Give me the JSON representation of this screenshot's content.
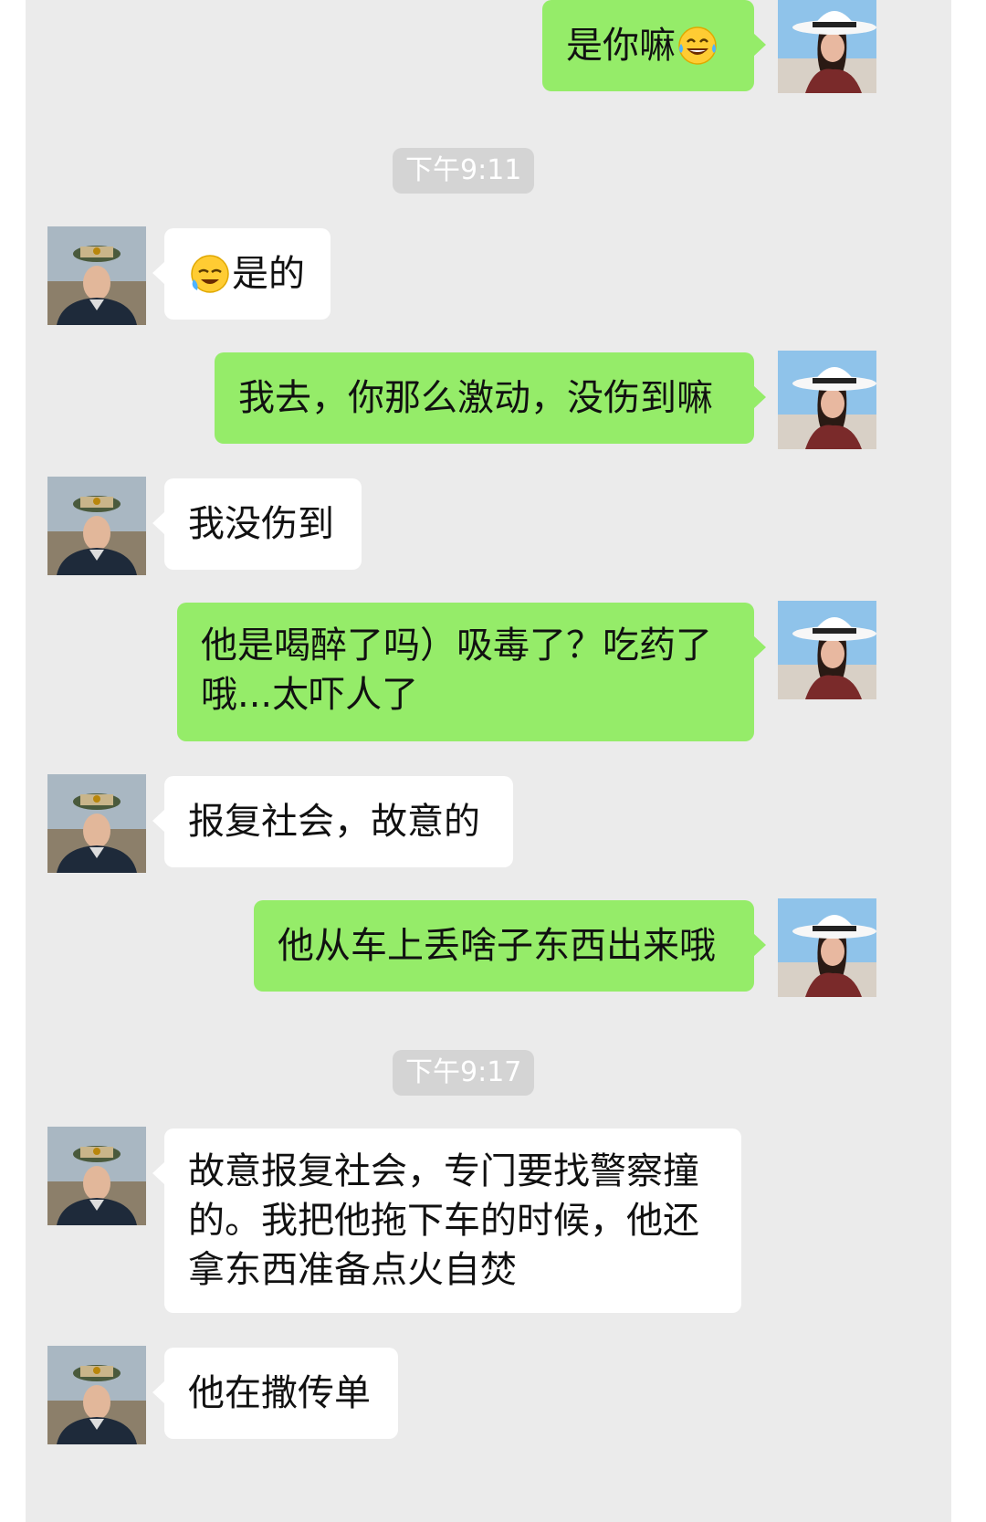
{
  "conversation": {
    "messages": [
      {
        "id": "m1",
        "side": "right",
        "text": "是你嘛",
        "emoji": "tears-of-joy-emoji"
      },
      {
        "id": "t1",
        "type": "time",
        "text": "下午9:11"
      },
      {
        "id": "m2",
        "side": "left",
        "emoji": "crying-laughing-emoji",
        "text": "是的"
      },
      {
        "id": "m3",
        "side": "right",
        "text": "我去，你那么激动，没伤到嘛"
      },
      {
        "id": "m4",
        "side": "left",
        "text": "我没伤到"
      },
      {
        "id": "m5",
        "side": "right",
        "lines": [
          "他是喝醉了吗）吸毒了？吃药了",
          "哦...太吓人了"
        ]
      },
      {
        "id": "m6",
        "side": "left",
        "text": "报复社会，故意的"
      },
      {
        "id": "m7",
        "side": "right",
        "text": "他从车上丢啥子东西出来哦"
      },
      {
        "id": "t2",
        "type": "time",
        "text": "下午9:17"
      },
      {
        "id": "m8",
        "side": "left",
        "lines": [
          "故意报复社会，专门要找警察撞",
          "的。我把他拖下车的时候，他还",
          "拿东西准备点火自焚"
        ]
      },
      {
        "id": "m9",
        "side": "left",
        "text": "他在撒传单"
      }
    ]
  },
  "colors": {
    "background": "#ebebeb",
    "outgoing_bubble": "#95ec69",
    "incoming_bubble": "#ffffff",
    "timestamp_bg": "#d4d4d4"
  }
}
